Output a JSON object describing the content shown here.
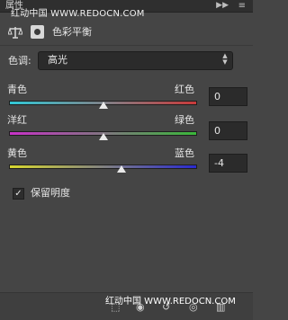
{
  "tabbar": {
    "title": "属性",
    "collapse_icon": "▶▶",
    "menu_icon": "≡"
  },
  "watermark_top": "红动中国 WWW.REDOCN.COM",
  "panel": {
    "title": "色彩平衡"
  },
  "tone": {
    "label": "色调:",
    "value": "高光"
  },
  "sliders": [
    {
      "left": "青色",
      "right": "红色",
      "value": "0",
      "position": 0.5,
      "gradient": [
        "#32c8d6",
        "#c83a3a"
      ]
    },
    {
      "left": "洋红",
      "right": "绿色",
      "value": "0",
      "position": 0.5,
      "gradient": [
        "#c832c8",
        "#3ab83a"
      ]
    },
    {
      "left": "黄色",
      "right": "蓝色",
      "value": "-4",
      "position": 0.6,
      "gradient": [
        "#d8d830",
        "#2a2ad0"
      ]
    }
  ],
  "preserve_luminosity": {
    "label": "保留明度",
    "checked": true
  },
  "footer": {
    "icons": [
      "clip-icon",
      "eye-view-icon",
      "reset-icon",
      "visibility-icon",
      "trash-icon"
    ]
  },
  "watermark_bottom": "红动中国 WWW.REDOCN.COM"
}
